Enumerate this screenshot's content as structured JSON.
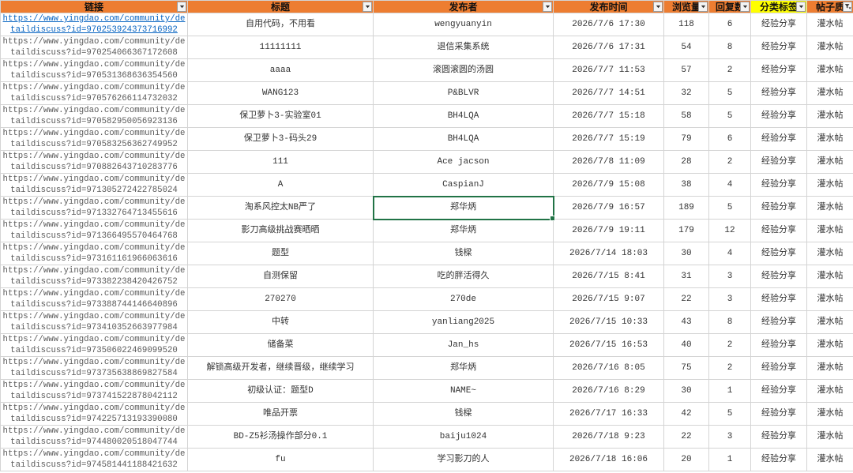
{
  "colors": {
    "header_fill": "#ED7D31",
    "header_highlight_fill": "#FFFF00",
    "hyperlink": "#0563C1",
    "selection": "#217346",
    "gridline": "#D4D4D4"
  },
  "sheet": {
    "columns": [
      {
        "label": "链接",
        "icon": "chevron-down-icon"
      },
      {
        "label": "标题",
        "icon": "chevron-down-icon"
      },
      {
        "label": "发布者",
        "icon": "chevron-down-icon"
      },
      {
        "label": "发布时间",
        "icon": "chevron-down-icon"
      },
      {
        "label": "浏览量",
        "icon": "chevron-down-icon"
      },
      {
        "label": "回复数",
        "icon": "chevron-down-icon"
      },
      {
        "label": "分类标签",
        "icon": "chevron-down-icon",
        "highlighted": true
      },
      {
        "label": "帖子质",
        "icon": "filter-active-icon"
      }
    ],
    "rows": [
      {
        "link": "https://www.yingdao.com/community/detaildiscuss?id=970253924373716992",
        "title": "自用代码，不用看",
        "publisher": "wengyuanyin",
        "time": "2026/7/6 17:30",
        "views": 118,
        "replies": 6,
        "category": "经验分享",
        "quality": "灌水帖",
        "hyperlink": true
      },
      {
        "link": "https://www.yingdao.com/community/detaildiscuss?id=970254066367172608",
        "title": "11111111",
        "publisher": "退信采集系统",
        "time": "2026/7/6 17:31",
        "views": 54,
        "replies": 8,
        "category": "经验分享",
        "quality": "灌水帖"
      },
      {
        "link": "https://www.yingdao.com/community/detaildiscuss?id=970531368636354560",
        "title": "aaaa",
        "publisher": "滚圆滚圆的汤圆",
        "time": "2026/7/7 11:53",
        "views": 57,
        "replies": 2,
        "category": "经验分享",
        "quality": "灌水帖"
      },
      {
        "link": "https://www.yingdao.com/community/detaildiscuss?id=970576266114732032",
        "title": "WANG123",
        "publisher": "P&BLVR",
        "time": "2026/7/7 14:51",
        "views": 32,
        "replies": 5,
        "category": "经验分享",
        "quality": "灌水帖"
      },
      {
        "link": "https://www.yingdao.com/community/detaildiscuss?id=970582950056923136",
        "title": "保卫萝卜3-实验室01",
        "publisher": "BH4LQA",
        "time": "2026/7/7 15:18",
        "views": 58,
        "replies": 5,
        "category": "经验分享",
        "quality": "灌水帖"
      },
      {
        "link": "https://www.yingdao.com/community/detaildiscuss?id=970583256362749952",
        "title": "保卫萝卜3-码头29",
        "publisher": "BH4LQA",
        "time": "2026/7/7 15:19",
        "views": 79,
        "replies": 6,
        "category": "经验分享",
        "quality": "灌水帖"
      },
      {
        "link": "https://www.yingdao.com/community/detaildiscuss?id=970882643710283776",
        "title": "111",
        "publisher": "Ace jacson",
        "time": "2026/7/8 11:09",
        "views": 28,
        "replies": 2,
        "category": "经验分享",
        "quality": "灌水帖"
      },
      {
        "link": "https://www.yingdao.com/community/detaildiscuss?id=971305272422785024",
        "title": "A",
        "publisher": "CaspianJ",
        "time": "2026/7/9 15:08",
        "views": 38,
        "replies": 4,
        "category": "经验分享",
        "quality": "灌水帖"
      },
      {
        "link": "https://www.yingdao.com/community/detaildiscuss?id=971332764713455616",
        "title": "淘系风控太NB严了",
        "publisher": "郑华炳",
        "time": "2026/7/9 16:57",
        "views": 189,
        "replies": 5,
        "category": "经验分享",
        "quality": "灌水帖",
        "publisher_selected": true
      },
      {
        "link": "https://www.yingdao.com/community/detaildiscuss?id=971366495570464768",
        "title": "影刀高级挑战赛晒晒",
        "publisher": "郑华炳",
        "time": "2026/7/9 19:11",
        "views": 179,
        "replies": 12,
        "category": "经验分享",
        "quality": "灌水帖"
      },
      {
        "link": "https://www.yingdao.com/community/detaildiscuss?id=973161161966063616",
        "title": "题型",
        "publisher": "钱樑",
        "time": "2026/7/14 18:03",
        "views": 30,
        "replies": 4,
        "category": "经验分享",
        "quality": "灌水帖"
      },
      {
        "link": "https://www.yingdao.com/community/detaildiscuss?id=973382238420426752",
        "title": "自测保留",
        "publisher": "吃的胖活得久",
        "time": "2026/7/15 8:41",
        "views": 31,
        "replies": 3,
        "category": "经验分享",
        "quality": "灌水帖"
      },
      {
        "link": "https://www.yingdao.com/community/detaildiscuss?id=973388744146640896",
        "title": "270270",
        "publisher": "270de",
        "time": "2026/7/15 9:07",
        "views": 22,
        "replies": 3,
        "category": "经验分享",
        "quality": "灌水帖"
      },
      {
        "link": "https://www.yingdao.com/community/detaildiscuss?id=973410352663977984",
        "title": "中转",
        "publisher": "yanliang2025",
        "time": "2026/7/15 10:33",
        "views": 43,
        "replies": 8,
        "category": "经验分享",
        "quality": "灌水帖"
      },
      {
        "link": "https://www.yingdao.com/community/detaildiscuss?id=973506022469099520",
        "title": "储备菜",
        "publisher": "Jan_hs",
        "time": "2026/7/15 16:53",
        "views": 40,
        "replies": 2,
        "category": "经验分享",
        "quality": "灌水帖"
      },
      {
        "link": "https://www.yingdao.com/community/detaildiscuss?id=973735638869827584",
        "title": "解锁高级开发者，继续晋级，继续学习",
        "publisher": "郑华炳",
        "time": "2026/7/16 8:05",
        "views": 75,
        "replies": 2,
        "category": "经验分享",
        "quality": "灌水帖"
      },
      {
        "link": "https://www.yingdao.com/community/detaildiscuss?id=973741522878042112",
        "title": "初级认证：题型D",
        "publisher": "NAME~",
        "time": "2026/7/16 8:29",
        "views": 30,
        "replies": 1,
        "category": "经验分享",
        "quality": "灌水帖"
      },
      {
        "link": "https://www.yingdao.com/community/detaildiscuss?id=974225713193390080",
        "title": "唯品开票",
        "publisher": "钱樑",
        "time": "2026/7/17 16:33",
        "views": 42,
        "replies": 5,
        "category": "经验分享",
        "quality": "灌水帖"
      },
      {
        "link": "https://www.yingdao.com/community/detaildiscuss?id=974480020518047744",
        "title": "BD-Z5衫汤操作部分0.1",
        "publisher": "baiju1024",
        "time": "2026/7/18 9:23",
        "views": 22,
        "replies": 3,
        "category": "经验分享",
        "quality": "灌水帖"
      },
      {
        "link": "https://www.yingdao.com/community/detaildiscuss?id=974581441188421632",
        "title": "fu",
        "publisher": "学习影刀的人",
        "time": "2026/7/18 16:06",
        "views": 20,
        "replies": 1,
        "category": "经验分享",
        "quality": "灌水帖"
      }
    ]
  }
}
